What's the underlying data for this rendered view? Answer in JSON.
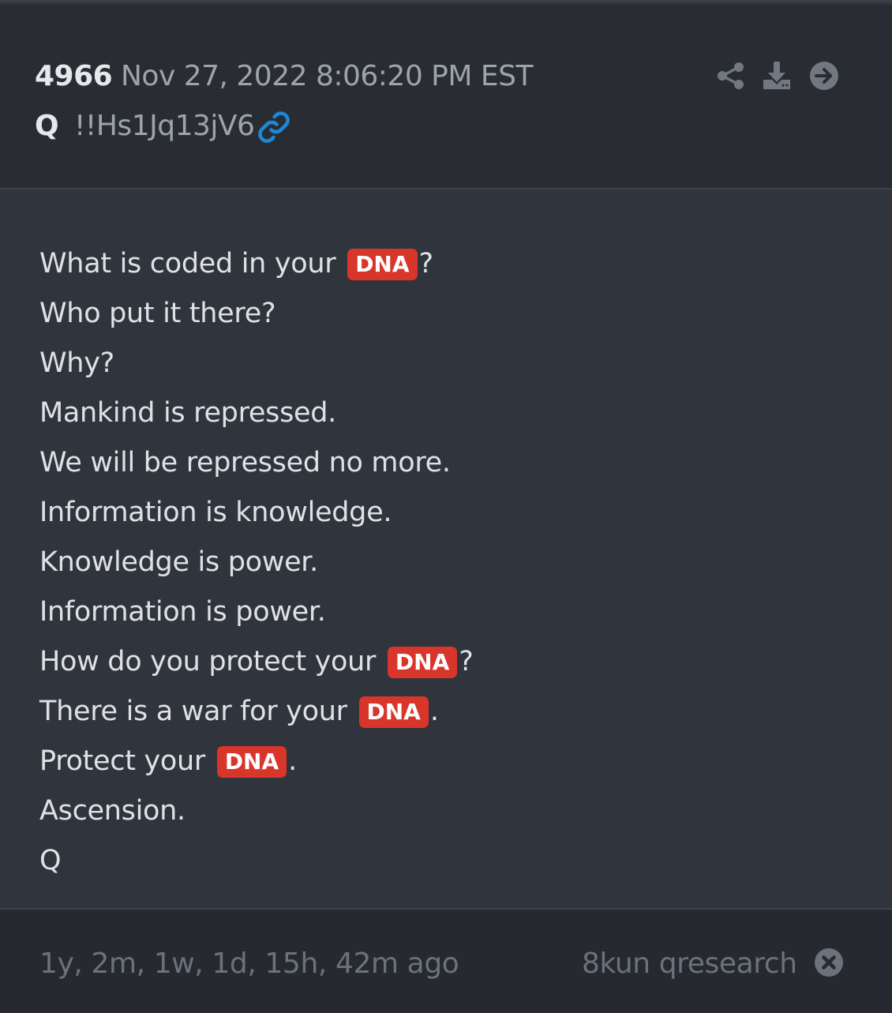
{
  "header": {
    "post_number": "4966",
    "timestamp": "Nov 27, 2022 8:06:20 PM EST",
    "author": "Q",
    "tripcode": "!!Hs1Jq13jV6",
    "icons": [
      "link-icon",
      "share-icon",
      "download-icon",
      "arrow-right-circle-icon"
    ]
  },
  "body": {
    "tag_color": "#d8352b",
    "lines": [
      {
        "before": "What is coded in your",
        "tag": "DNA",
        "after": "?"
      },
      {
        "text": "Who put it there?"
      },
      {
        "text": "Why?"
      },
      {
        "text": "Mankind is repressed."
      },
      {
        "text": "We will be repressed no more."
      },
      {
        "text": "Information is knowledge."
      },
      {
        "text": "Knowledge is power."
      },
      {
        "text": "Information is power."
      },
      {
        "before": "How do you protect your",
        "tag": "DNA",
        "after": "?"
      },
      {
        "before": "There is a war for your",
        "tag": "DNA",
        "after": "."
      },
      {
        "before": "Protect your",
        "tag": "DNA",
        "after": "."
      },
      {
        "text": "Ascension."
      },
      {
        "text": "Q"
      }
    ]
  },
  "footer": {
    "age": "1y, 2m, 1w, 1d, 15h, 42m ago",
    "source": "8kun qresearch",
    "icon": "close-circle-icon"
  },
  "colors": {
    "link_blue": "#1f88d6",
    "header_bg": "#292d33",
    "body_bg": "#30353d",
    "footer_bg": "#262a30"
  }
}
